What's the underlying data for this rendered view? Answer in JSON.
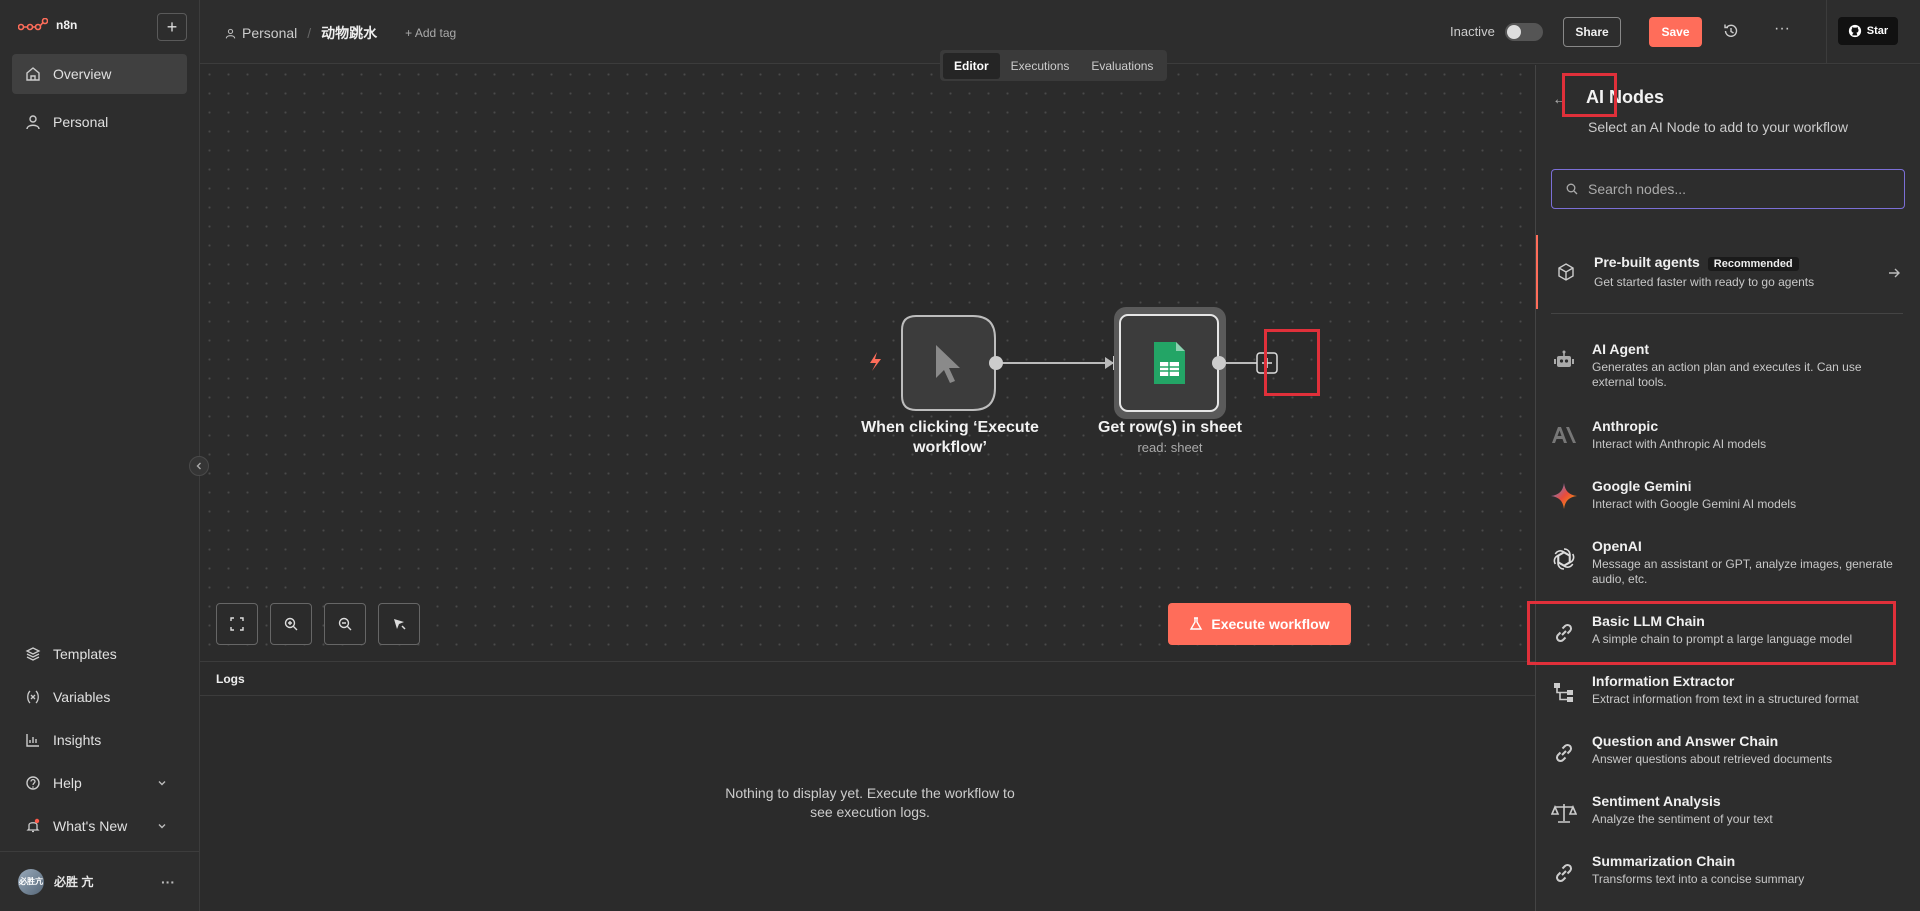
{
  "app": {
    "logo_text": "n8n"
  },
  "sidebar": {
    "items": [
      {
        "label": "Overview",
        "icon": "home-icon"
      },
      {
        "label": "Personal",
        "icon": "user-icon"
      }
    ],
    "bottom_items": [
      {
        "label": "Templates",
        "icon": "templates-icon"
      },
      {
        "label": "Variables",
        "icon": "variables-icon"
      },
      {
        "label": "Insights",
        "icon": "insights-icon"
      },
      {
        "label": "Help",
        "icon": "help-icon"
      },
      {
        "label": "What's New",
        "icon": "bell-icon"
      }
    ],
    "user": {
      "name": "必胜 亢",
      "avatar_text": "必胜亢"
    }
  },
  "header": {
    "project": "Personal",
    "workflow_name": "动物跳水",
    "add_tag": "+ Add tag",
    "status": "Inactive",
    "share": "Share",
    "save": "Save",
    "star": "Star"
  },
  "canvas": {
    "tabs": [
      "Editor",
      "Executions",
      "Evaluations"
    ],
    "active_tab": "Editor",
    "nodes": [
      {
        "label": "When clicking ‘Execute workflow’",
        "subtitle": ""
      },
      {
        "label": "Get row(s) in sheet",
        "subtitle": "read: sheet"
      }
    ],
    "execute_button": "Execute workflow"
  },
  "logs": {
    "title": "Logs",
    "empty_text": "Nothing to display yet. Execute the workflow to see execution logs."
  },
  "panel": {
    "title": "AI Nodes",
    "subtitle": "Select an AI Node to add to your workflow",
    "search_placeholder": "Search nodes...",
    "prebuilt": {
      "title": "Pre-built agents",
      "badge": "Recommended",
      "description": "Get started faster with ready to go agents"
    },
    "items": [
      {
        "title": "AI Agent",
        "description": "Generates an action plan and executes it. Can use external tools.",
        "icon": "robot-icon"
      },
      {
        "title": "Anthropic",
        "description": "Interact with Anthropic AI models",
        "icon": "anthropic-icon"
      },
      {
        "title": "Google Gemini",
        "description": "Interact with Google Gemini AI models",
        "icon": "gemini-icon"
      },
      {
        "title": "OpenAI",
        "description": "Message an assistant or GPT, analyze images, generate audio, etc.",
        "icon": "openai-icon"
      },
      {
        "title": "Basic LLM Chain",
        "description": "A simple chain to prompt a large language model",
        "icon": "link-icon"
      },
      {
        "title": "Information Extractor",
        "description": "Extract information from text in a structured format",
        "icon": "extractor-icon"
      },
      {
        "title": "Question and Answer Chain",
        "description": "Answer questions about retrieved documents",
        "icon": "link-icon"
      },
      {
        "title": "Sentiment Analysis",
        "description": "Analyze the sentiment of your text",
        "icon": "scale-icon"
      },
      {
        "title": "Summarization Chain",
        "description": "Transforms text into a concise summary",
        "icon": "link-icon"
      }
    ]
  },
  "colors": {
    "accent": "#ff6d5a",
    "highlight": "#e0303a",
    "search_border": "#7b6fd6"
  }
}
